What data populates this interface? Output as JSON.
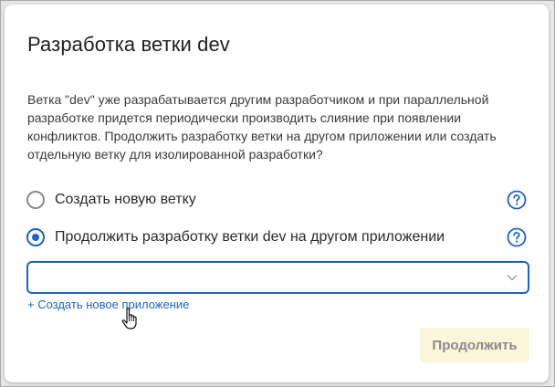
{
  "dialog": {
    "title": "Разработка ветки dev",
    "description": "Ветка \"dev\" уже разрабатывается другим разработчиком и при параллельной разработке придется периодически производить слияние при появлении конфликтов. Продолжить разработку ветки на другом приложении или создать отдельную ветку для изолированной разработки?",
    "options": [
      {
        "label": "Создать новую ветку",
        "selected": false,
        "icon": "help-circle-icon"
      },
      {
        "label": "Продолжить разработку ветки dev на другом приложении",
        "selected": true,
        "icon": "help-circle-icon"
      }
    ],
    "app_select": {
      "value": "",
      "icon": "chevron-down-icon"
    },
    "create_app_link": "+ Создать новое приложение",
    "continue_button": "Продолжить"
  },
  "colors": {
    "accent": "#1f62c3",
    "button_bg_disabled": "#fbf7db",
    "button_text_disabled": "#8a8a8a"
  }
}
